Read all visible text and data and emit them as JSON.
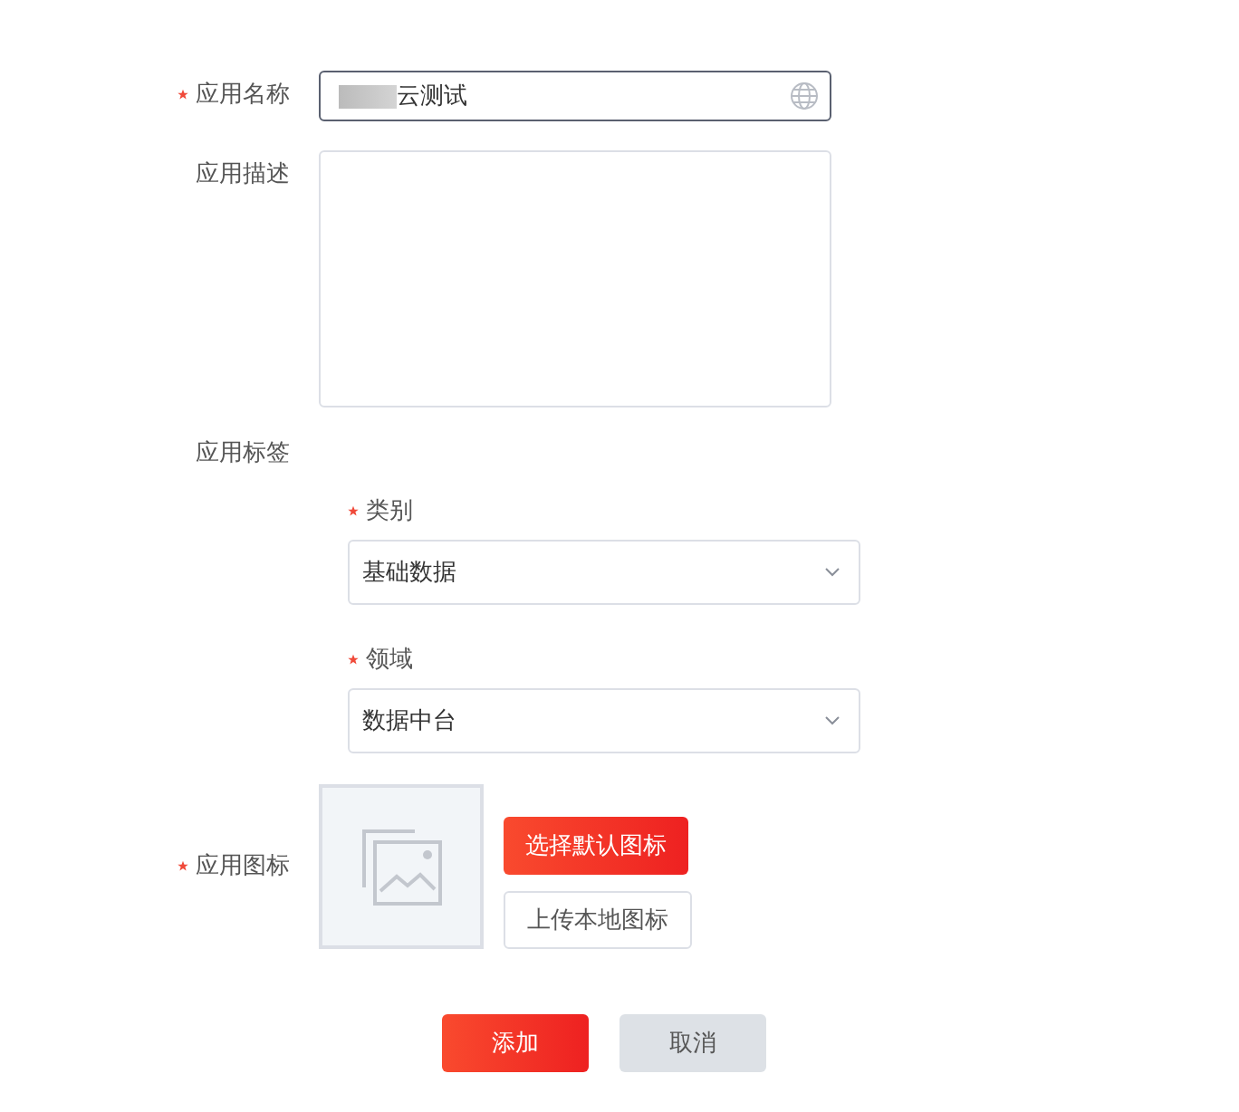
{
  "form": {
    "name": {
      "label": "应用名称",
      "required": true,
      "value": "云测试",
      "redacted": true
    },
    "description": {
      "label": "应用描述",
      "required": false
    },
    "tags": {
      "label": "应用标签",
      "required": false,
      "fields": [
        {
          "label": "类别",
          "required": true,
          "value": "基础数据"
        },
        {
          "label": "领域",
          "required": true,
          "value": "数据中台"
        }
      ]
    },
    "icon": {
      "label": "应用图标",
      "required": true,
      "buttons": [
        {
          "label": "选择默认图标",
          "kind": "primary"
        },
        {
          "label": "上传本地图标",
          "kind": "secondary"
        }
      ]
    }
  },
  "actions": [
    {
      "label": "添加",
      "kind": "primary"
    },
    {
      "label": "取消",
      "kind": "muted"
    }
  ]
}
